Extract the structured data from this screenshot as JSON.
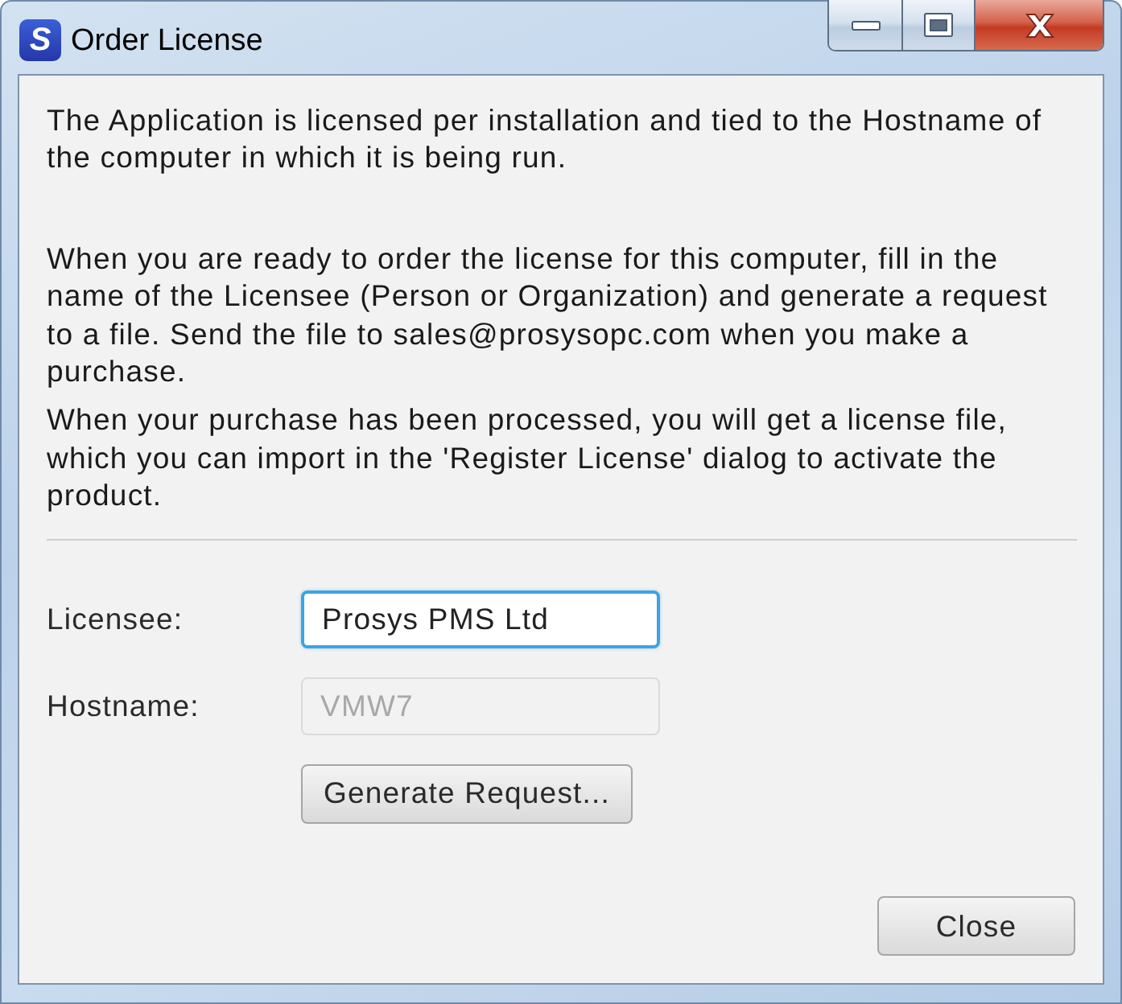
{
  "window": {
    "title": "Order License",
    "logo_letter": "S"
  },
  "paragraphs": [
    "The Application is licensed per installation and tied to the Hostname of\nthe computer in which it is being run.",
    "When you are ready to order the license for this computer, fill in the\nname of the Licensee (Person or Organization) and generate a request\nto a file. Send the file to sales@prosysopc.com when you make a\npurchase.",
    "When your purchase has been processed, you will get a license file,\nwhich you can import in the 'Register License' dialog to activate the\nproduct."
  ],
  "form": {
    "fields": [
      {
        "label": "Licensee:",
        "value": "Prosys PMS Ltd",
        "focused": true,
        "disabled": false
      },
      {
        "label": "Hostname:",
        "value": "VMW7",
        "focused": false,
        "disabled": true
      }
    ],
    "generate_button": "Generate Request..."
  },
  "buttons": [
    {
      "label": "Close"
    }
  ]
}
